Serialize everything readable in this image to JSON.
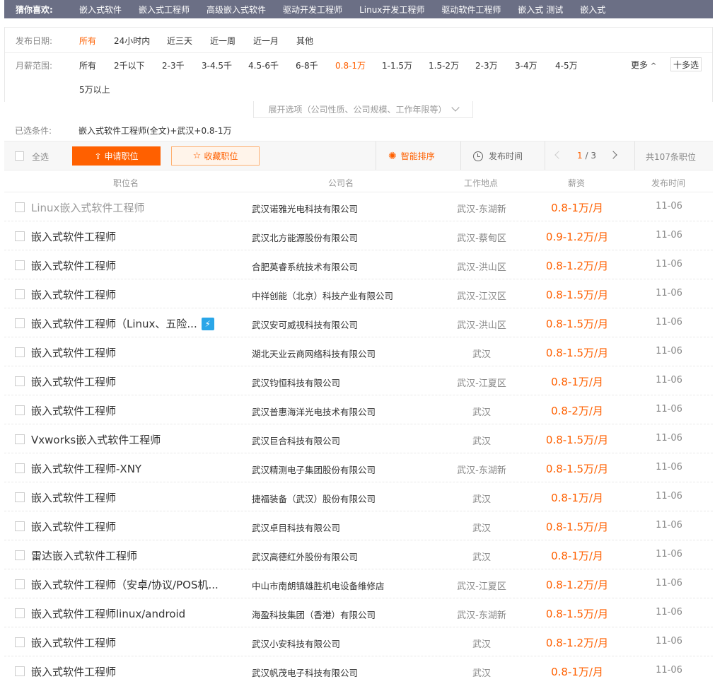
{
  "guess": {
    "label": "猜你喜欢:",
    "items": [
      "嵌入式软件",
      "嵌入式工程师",
      "高级嵌入式软件",
      "驱动开发工程师",
      "Linux开发工程师",
      "驱动软件工程师",
      "嵌入式 测试",
      "嵌入式"
    ]
  },
  "filters": {
    "date": {
      "label": "发布日期:",
      "options": [
        "所有",
        "24小时内",
        "近三天",
        "近一周",
        "近一月",
        "其他"
      ],
      "active": "所有"
    },
    "salary": {
      "label": "月薪范围:",
      "options": [
        "所有",
        "2千以下",
        "2-3千",
        "3-4.5千",
        "4.5-6千",
        "6-8千",
        "0.8-1万",
        "1-1.5万",
        "1.5-2万",
        "2-3万",
        "3-4万",
        "4-5万",
        "5万以上"
      ],
      "active": "0.8-1万"
    },
    "more_label": "更多",
    "multi_label": "十多选",
    "expand_label": "展开选项（公司性质、公司规模、工作年限等）",
    "selected_label": "已选条件:",
    "selected_value": "嵌入式软件工程师(全文)+武汉+0.8-1万"
  },
  "toolbar": {
    "select_all": "全选",
    "apply": "申请职位",
    "favorite": "收藏职位",
    "sort_smart": "智能排序",
    "sort_time": "发布时间",
    "page_current": "1",
    "page_total": "/ 3",
    "total_jobs": "共107条职位"
  },
  "table": {
    "headers": {
      "title": "职位名",
      "company": "公司名",
      "location": "工作地点",
      "salary": "薪资",
      "date": "发布时间"
    },
    "rows": [
      {
        "title": "Linux嵌入式软件工程师",
        "company": "武汉诺雅光电科技有限公司",
        "location": "武汉-东湖新",
        "salary": "0.8-1万/月",
        "date": "11-06"
      },
      {
        "title": "嵌入式软件工程师",
        "company": "武汉北方能源股份有限公司",
        "location": "武汉-蔡甸区",
        "salary": "0.9-1.2万/月",
        "date": "11-06"
      },
      {
        "title": "嵌入式软件工程师",
        "company": "合肥英睿系统技术有限公司",
        "location": "武汉-洪山区",
        "salary": "0.8-1.2万/月",
        "date": "11-06"
      },
      {
        "title": "嵌入式软件工程师",
        "company": "中祥创能（北京）科技产业有限公司",
        "location": "武汉-江汉区",
        "salary": "0.8-1.5万/月",
        "date": "11-06"
      },
      {
        "title": "嵌入式软件工程师（Linux、五险...",
        "company": "武汉安可威视科技有限公司",
        "location": "武汉-洪山区",
        "salary": "0.8-1.5万/月",
        "date": "11-06"
      },
      {
        "title": "嵌入式软件工程师",
        "company": "湖北天业云商网络科技有限公司",
        "location": "武汉",
        "salary": "0.8-1.5万/月",
        "date": "11-06"
      },
      {
        "title": "嵌入式软件工程师",
        "company": "武汉钧恒科技有限公司",
        "location": "武汉-江夏区",
        "salary": "0.8-1万/月",
        "date": "11-06"
      },
      {
        "title": "嵌入式软件工程师",
        "company": "武汉普惠海洋光电技术有限公司",
        "location": "武汉",
        "salary": "0.8-2万/月",
        "date": "11-06"
      },
      {
        "title": "Vxworks嵌入式软件工程师",
        "company": "武汉巨合科技有限公司",
        "location": "武汉",
        "salary": "0.8-1.5万/月",
        "date": "11-06"
      },
      {
        "title": "嵌入式软件工程师-XNY",
        "company": "武汉精测电子集团股份有限公司",
        "location": "武汉-东湖新",
        "salary": "0.8-1.5万/月",
        "date": "11-06"
      },
      {
        "title": "嵌入式软件工程师",
        "company": "捷福装备（武汉）股份有限公司",
        "location": "武汉",
        "salary": "0.8-1万/月",
        "date": "11-06"
      },
      {
        "title": "嵌入式软件工程师",
        "company": "武汉卓目科技有限公司",
        "location": "武汉",
        "salary": "0.8-1.5万/月",
        "date": "11-06"
      },
      {
        "title": "雷达嵌入式软件工程师",
        "company": "武汉高德红外股份有限公司",
        "location": "武汉",
        "salary": "0.8-1万/月",
        "date": "11-06"
      },
      {
        "title": "嵌入式软件工程师（安卓/协议/POS机...",
        "company": "中山市南朗镇雄胜机电设备维修店",
        "location": "武汉-江夏区",
        "salary": "0.8-1.2万/月",
        "date": "11-06"
      },
      {
        "title": "嵌入式软件工程师linux/android",
        "company": "海盈科技集团（香港）有限公司",
        "location": "武汉-东湖新",
        "salary": "0.8-1.5万/月",
        "date": "11-06"
      },
      {
        "title": "嵌入式软件工程师",
        "company": "武汉小安科技有限公司",
        "location": "武汉",
        "salary": "0.8-1.2万/月",
        "date": "11-06"
      },
      {
        "title": "嵌入式软件工程师",
        "company": "武汉帆茂电子科技有限公司",
        "location": "武汉",
        "salary": "0.8-1万/月",
        "date": "11-06"
      }
    ]
  }
}
